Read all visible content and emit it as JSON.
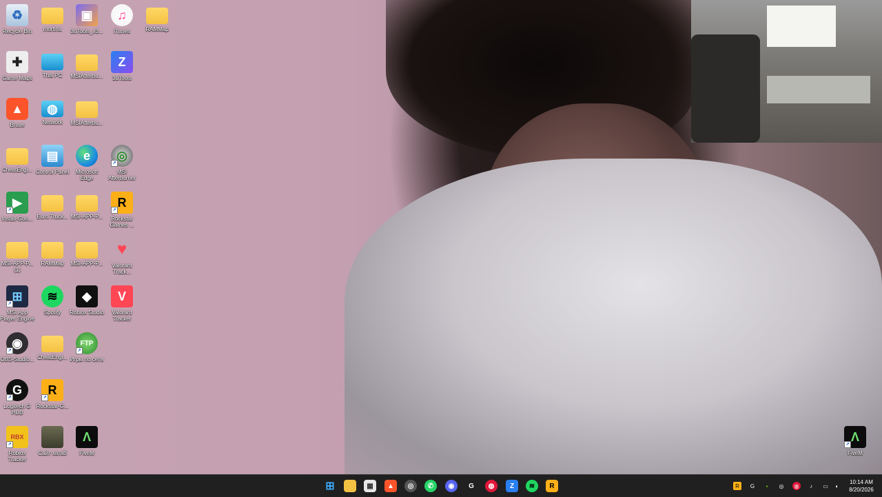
{
  "desktop": {
    "icons": [
      {
        "label": "Recycle Bin",
        "icon": "recycle-bin-icon"
      },
      {
        "label": "morfina",
        "icon": "folder-icon"
      },
      {
        "label": "3uTools_v3...",
        "icon": "package-icon"
      },
      {
        "label": "iTunes",
        "icon": "itunes-icon"
      },
      {
        "label": "RAMMap",
        "icon": "folder-icon"
      },
      {
        "label": "Game Maps",
        "icon": "gamepad-icon"
      },
      {
        "label": "This PC",
        "icon": "monitor-icon"
      },
      {
        "label": "MSIAfterbu...",
        "icon": "folder-icon"
      },
      {
        "label": "3uTools",
        "icon": "3utools-icon"
      },
      {
        "label": "Brave",
        "icon": "brave-icon"
      },
      {
        "label": "Network",
        "icon": "network-icon"
      },
      {
        "label": "MSIAfterbu...",
        "icon": "folder-icon"
      },
      {
        "label": "CheatEngi...",
        "icon": "folder-icon"
      },
      {
        "label": "Control Panel",
        "icon": "control-panel-icon"
      },
      {
        "label": "Microsoft Edge",
        "icon": "edge-icon"
      },
      {
        "label": "MSI Afterburner",
        "icon": "afterburner-icon"
      },
      {
        "label": "Install-Goo...",
        "icon": "google-play-icon"
      },
      {
        "label": "Euro.Truck...",
        "icon": "folder-icon"
      },
      {
        "label": "MSI-APP-P...",
        "icon": "folder-icon"
      },
      {
        "label": "Rockstar Games ...",
        "icon": "rockstar-icon"
      },
      {
        "label": "MSI-APP-P... (1)",
        "icon": "folder-icon"
      },
      {
        "label": "RAMMap",
        "icon": "folder-icon"
      },
      {
        "label": "MSI-APP-P...",
        "icon": "folder-icon"
      },
      {
        "label": "Valorant Track...",
        "icon": "valorant-icon"
      },
      {
        "label": "MSI App Player Engine",
        "icon": "msi-app-player-icon"
      },
      {
        "label": "Spotify",
        "icon": "spotify-icon"
      },
      {
        "label": "Roblox Studio",
        "icon": "roblox-studio-icon"
      },
      {
        "label": "Valorant Tracker",
        "icon": "valorant-tracker-icon"
      },
      {
        "label": "OBS-Studio...",
        "icon": "obs-icon"
      },
      {
        "label": "CheatEngi...",
        "icon": "folder-icon"
      },
      {
        "label": "Игры по сети",
        "icon": "ftp-icon"
      },
      {
        "label": "Logitech G HUB",
        "icon": "logitech-icon"
      },
      {
        "label": "Rockstar-G...",
        "icon": "rockstar-icon"
      },
      {
        "label": "Roblox Tracker",
        "icon": "roblox-tracker-icon"
      },
      {
        "label": "Сайт хатаб",
        "icon": "image-icon"
      },
      {
        "label": "FiveM",
        "icon": "fivem-icon"
      },
      {
        "label": "FiveM",
        "icon": "fivem-icon"
      }
    ]
  },
  "taskbar": {
    "pinned": [
      "start-icon",
      "file-explorer-icon",
      "store-icon",
      "brave-icon",
      "afterburner-icon",
      "whatsapp-icon",
      "discord-icon",
      "logitech-icon",
      "app-red-icon",
      "3utools-icon",
      "spotify-icon",
      "rockstar-icon"
    ],
    "glyphs": {
      "start": "⊞",
      "files": "",
      "store": "▦",
      "brave": "▲",
      "afterburner": "◎",
      "whatsapp": "✆",
      "discord": "◉",
      "logitech": "G",
      "app_red": "◍",
      "3utools": "Z",
      "spotify": "≋",
      "rockstar": "R"
    },
    "tray_glyphs": {
      "rockstar": "R",
      "logitech": "G",
      "nvidia": "▪",
      "afterburner": "◎",
      "app": "◍",
      "mic": "♪",
      "display": "▭",
      "volume": "◖"
    },
    "clock": {
      "time": "10:14 AM",
      "date": "8/20/2026"
    }
  },
  "colors": {
    "taskbar": "#202020",
    "wallpaper": "#c3a0af"
  }
}
